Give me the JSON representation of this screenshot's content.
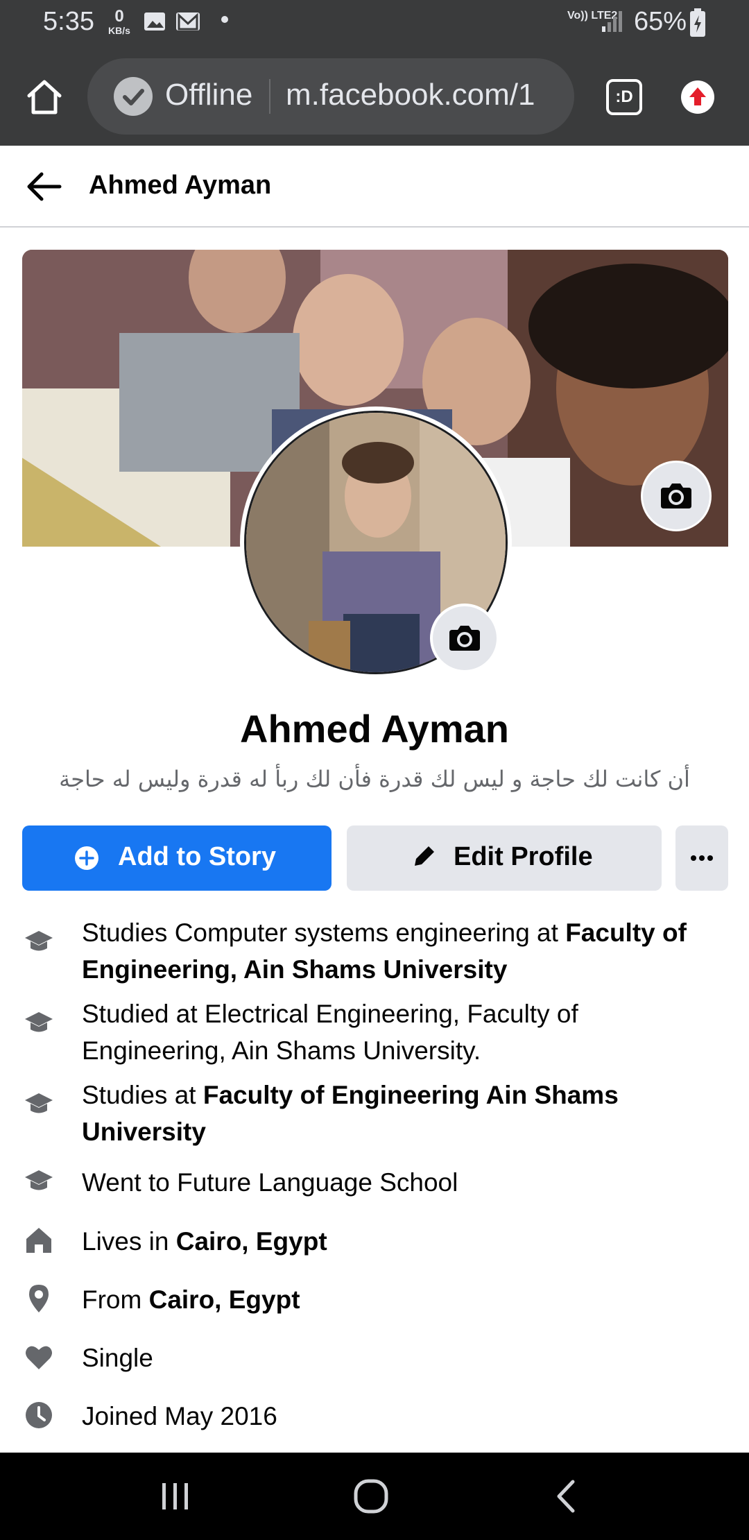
{
  "status_bar": {
    "time": "5:35",
    "net_speed_value": "0",
    "net_speed_unit": "KB/s",
    "network": "Vo)) LTE2",
    "battery": "65%"
  },
  "browser": {
    "offline_label": "Offline",
    "url": "m.facebook.com/1",
    "tabs_label": ":D"
  },
  "header": {
    "title": "Ahmed Ayman"
  },
  "profile": {
    "name": "Ahmed Ayman",
    "bio": "أن كانت لك حاجة و ليس لك قدرة فأن لك ربأ له قدرة وليس له حاجة",
    "add_to_story_label": "Add to Story",
    "edit_profile_label": "Edit Profile",
    "more_label": "···"
  },
  "intro": [
    {
      "icon": "graduation-cap-icon",
      "prefix": "Studies Computer systems engineering at ",
      "bold": "Faculty of Engineering, Ain Shams University"
    },
    {
      "icon": "graduation-cap-icon",
      "prefix": "Studied at Electrical Engineering, Faculty of Engineering, Ain Shams University.",
      "bold": ""
    },
    {
      "icon": "graduation-cap-icon",
      "prefix": "Studies at ",
      "bold": "Faculty of Engineering Ain Shams University"
    },
    {
      "icon": "graduation-cap-icon",
      "prefix": "Went to Future Language School",
      "bold": ""
    },
    {
      "icon": "home-icon",
      "prefix": "Lives in ",
      "bold": "Cairo, Egypt"
    },
    {
      "icon": "location-pin-icon",
      "prefix": "From ",
      "bold": "Cairo, Egypt"
    },
    {
      "icon": "heart-icon",
      "prefix": "Single",
      "bold": ""
    },
    {
      "icon": "clock-icon",
      "prefix": "Joined May 2016",
      "bold": ""
    }
  ],
  "colors": {
    "brand_blue": "#1877f2",
    "secondary_button": "#e4e6eb",
    "browser_chrome": "#3a3b3c",
    "muted_text": "#65676b"
  }
}
